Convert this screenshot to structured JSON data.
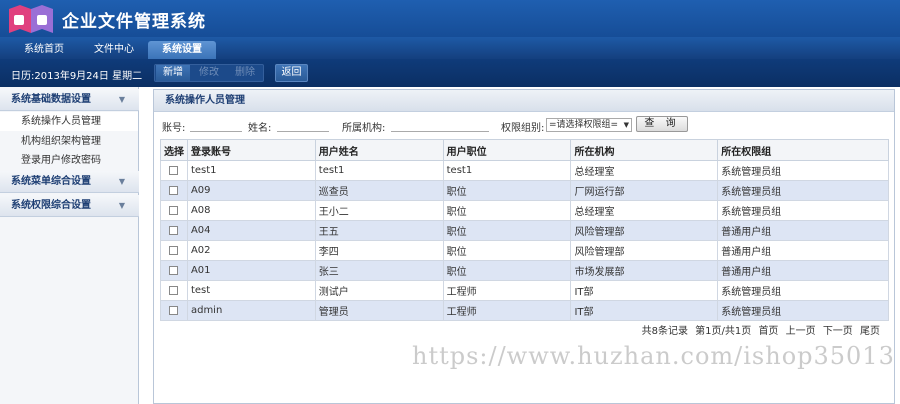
{
  "app": {
    "title": "企业文件管理系统"
  },
  "nav": {
    "tabs": [
      "系统首页",
      "文件中心",
      "系统设置"
    ]
  },
  "toolbar": {
    "date": "日历:2013年9月24日 星期二",
    "buttons": [
      "新增",
      "修改",
      "删除"
    ],
    "back": "返回"
  },
  "sidebar": {
    "sections": [
      "系统基础数据设置",
      "系统菜单综合设置",
      "系统权限综合设置"
    ],
    "items": [
      "系统操作人员管理",
      "机构组织架构管理",
      "登录用户修改密码"
    ]
  },
  "main": {
    "title": "系统操作人员管理",
    "search": {
      "account_label": "账号:",
      "name_label": "姓名:",
      "org_label": "所属机构:",
      "group_label": "权限组别:",
      "group_select": "=请选择权限组=",
      "query_button": "查 询"
    },
    "table": {
      "headers": [
        "选择",
        "登录账号",
        "用户姓名",
        "用户职位",
        "所在机构",
        "所在权限组"
      ],
      "rows": [
        [
          "test1",
          "test1",
          "test1",
          "总经理室",
          "系统管理员组"
        ],
        [
          "A09",
          "巡查员",
          "职位",
          "厂网运行部",
          "系统管理员组"
        ],
        [
          "A08",
          "王小二",
          "职位",
          "总经理室",
          "系统管理员组"
        ],
        [
          "A04",
          "王五",
          "职位",
          "风险管理部",
          "普通用户组"
        ],
        [
          "A02",
          "李四",
          "职位",
          "风险管理部",
          "普通用户组"
        ],
        [
          "A01",
          "张三",
          "职位",
          "市场发展部",
          "普通用户组"
        ],
        [
          "test",
          "测试户",
          "工程师",
          "IT部",
          "系统管理员组"
        ],
        [
          "admin",
          "管理员",
          "工程师",
          "IT部",
          "系统管理员组"
        ]
      ]
    },
    "pager": {
      "summary": "共8条记录",
      "page_info": "第1页/共1页",
      "first": "首页",
      "prev": "上一页",
      "next": "下一页",
      "last": "尾页"
    }
  },
  "watermark": "https://www.huzhan.com/ishop35013",
  "colors": {
    "header": "#1f5fb0",
    "toolbar": "#0f3b7a",
    "row_alt": "#dde5f4",
    "logo_pink": "#e0407f",
    "logo_purple": "#9a6fd6"
  }
}
